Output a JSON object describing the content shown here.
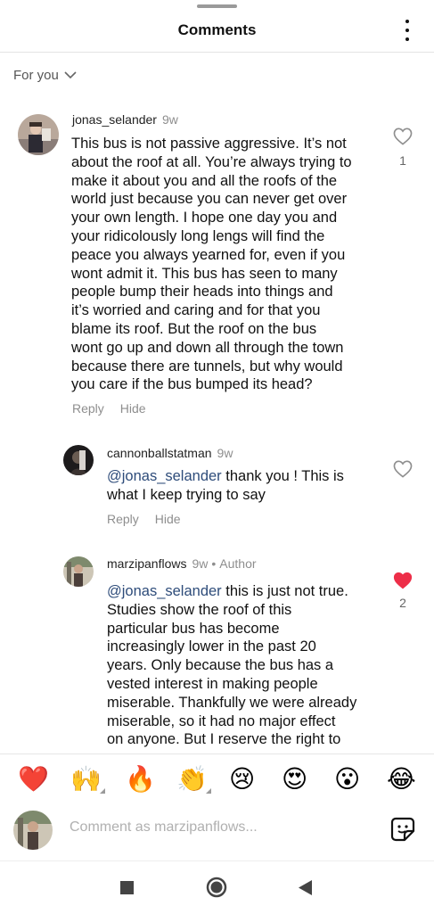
{
  "header": {
    "title": "Comments",
    "more_icon": "more-vertical-icon"
  },
  "sort": {
    "label": "For you",
    "icon": "chevron-down-icon"
  },
  "comments": [
    {
      "username": "jonas_selander",
      "time": "9w",
      "text_lines": [
        "This bus is not passive aggressive. It’s not",
        "about the roof at all. You’re always trying to",
        "make it about you and all the roofs of the",
        "world just because you can never get over",
        "your own length. I hope one day you and",
        "your ridicolously long lengs will find the",
        "peace you always yearned for, even if you",
        "wont admit it. This bus has seen to many",
        "people bump their heads into things and",
        "it’s worried and caring and for that you",
        "blame its roof. But the roof on the bus",
        "wont go up and down all through the town",
        "because there are tunnels, but why would",
        "you care if the bus bumped its head?"
      ],
      "reply_label": "Reply",
      "hide_label": "Hide",
      "likes": "1",
      "liked": false
    },
    {
      "username": "cannonballstatman",
      "time": "9w",
      "mention": "@jonas_selander",
      "text_first": " thank you ! This is",
      "text_lines": [
        "what I keep trying to say"
      ],
      "reply_label": "Reply",
      "hide_label": "Hide",
      "liked": false
    },
    {
      "username": "marzipanflows",
      "time": "9w",
      "author_badge": "Author",
      "mention": "@jonas_selander",
      "text_first": " this is just not true.",
      "text_lines": [
        "Studies show the roof of this",
        "particular bus has become",
        "increasingly lower in the past 20",
        "years. Only because the bus has a",
        "vested interest in making people",
        "miserable. Thankfully we were already",
        "miserable, so it had no major effect",
        "on anyone. But I reserve the right to"
      ],
      "likes": "2",
      "liked": true
    }
  ],
  "emoji_bar": [
    "❤️",
    "🙌",
    "🔥",
    "👏",
    "😢",
    "😍",
    "😮",
    "😂"
  ],
  "composer": {
    "placeholder": "Comment as marzipanflows...",
    "sticker_icon": "sticker-icon"
  },
  "colors": {
    "mention": "#2e4c7a",
    "liked": "#ed2e48",
    "muted": "#8e8e8e"
  }
}
